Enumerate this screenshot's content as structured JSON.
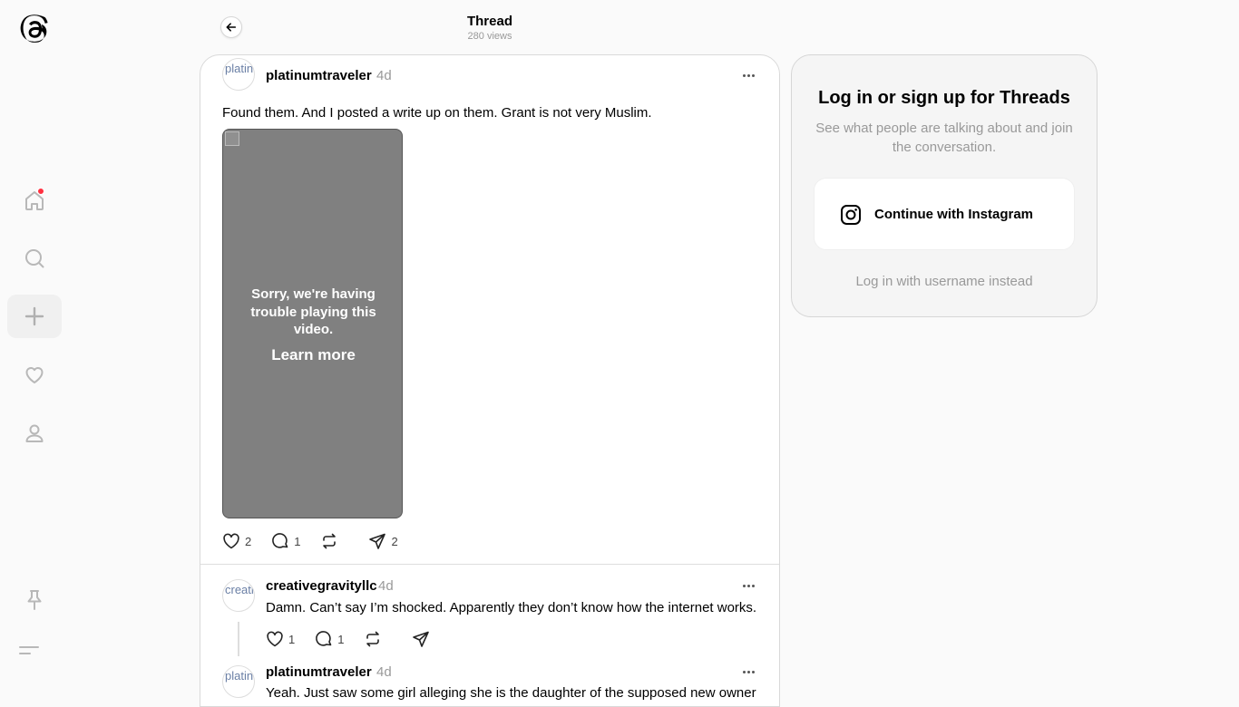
{
  "sidebar": {
    "logo": "threads-logo",
    "items": [
      {
        "name": "home",
        "icon": "home-icon",
        "has_notification": true
      },
      {
        "name": "search",
        "icon": "search-icon"
      },
      {
        "name": "create",
        "icon": "plus-icon"
      },
      {
        "name": "activity",
        "icon": "heart-icon"
      },
      {
        "name": "profile",
        "icon": "person-icon"
      }
    ],
    "bottom": [
      {
        "name": "pin",
        "icon": "pin-icon"
      },
      {
        "name": "menu",
        "icon": "menu-icon"
      }
    ]
  },
  "header": {
    "title": "Thread",
    "views": "280 views"
  },
  "posts": [
    {
      "avatar_alt": "platinumtraveler",
      "username": "platinumtraveler",
      "time": "4d",
      "text": "Found them. And I posted a write up on them. Grant is not very Muslim.",
      "video": {
        "error_text": "Sorry, we're having trouble playing this video.",
        "learn_more": "Learn more"
      },
      "likes": "2",
      "replies": "1",
      "reposts": "",
      "shares": "2"
    },
    {
      "avatar_alt": "creativegravityllc",
      "username": "creativegravityllc",
      "time": "4d",
      "text": "Damn. Can’t say I’m shocked. Apparently they don’t know how the internet works.",
      "likes": "1",
      "replies": "1",
      "reposts": "",
      "shares": ""
    },
    {
      "avatar_alt": "platinumtraveler",
      "username": "platinumtraveler",
      "time": "4d",
      "text": "Yeah. Just saw some girl alleging she is the daughter of the supposed new owner"
    }
  ],
  "login": {
    "title": "Log in or sign up for Threads",
    "subtitle": "See what people are talking about and join the conversation.",
    "instagram_button": "Continue with Instagram",
    "username_link": "Log in with username instead"
  },
  "colors": {
    "notification": "#ff3040",
    "secondary_text": "#999999",
    "video_bg": "#808080"
  }
}
